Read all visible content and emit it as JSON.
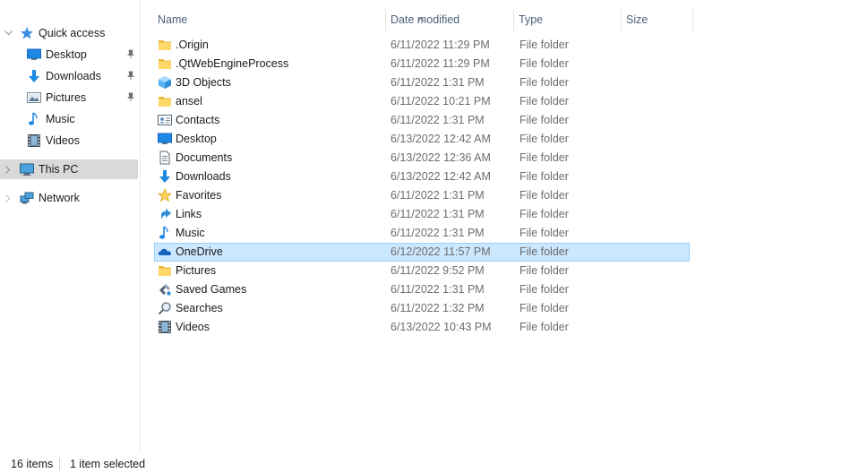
{
  "colors": {
    "accent": "#0078d7",
    "selection_bg": "#cce8ff",
    "selection_border": "#99d1ff",
    "nav_selected_bg": "#d9d9d9",
    "header_text": "#4c607a",
    "folder_yellow": "#ffd869"
  },
  "nav": {
    "items": [
      {
        "label": "Quick access",
        "icon": "star-icon",
        "pinned": false
      },
      {
        "label": "Desktop",
        "icon": "desktop-icon",
        "pinned": true
      },
      {
        "label": "Downloads",
        "icon": "download-icon",
        "pinned": true
      },
      {
        "label": "Pictures",
        "icon": "pictures-icon",
        "pinned": true
      },
      {
        "label": "Music",
        "icon": "music-icon",
        "pinned": false
      },
      {
        "label": "Videos",
        "icon": "videos-icon",
        "pinned": false
      },
      {
        "label": "This PC",
        "icon": "computer-icon",
        "pinned": false,
        "selected": true
      },
      {
        "label": "Network",
        "icon": "network-icon",
        "pinned": false
      }
    ]
  },
  "columns": {
    "name": "Name",
    "date_modified": "Date modified",
    "type": "Type",
    "size": "Size"
  },
  "files": [
    {
      "name": ".Origin",
      "date": "6/11/2022 11:29 PM",
      "type": "File folder",
      "icon": "folder-icon"
    },
    {
      "name": ".QtWebEngineProcess",
      "date": "6/11/2022 11:29 PM",
      "type": "File folder",
      "icon": "folder-icon"
    },
    {
      "name": "3D Objects",
      "date": "6/11/2022 1:31 PM",
      "type": "File folder",
      "icon": "3d-objects-icon"
    },
    {
      "name": "ansel",
      "date": "6/11/2022 10:21 PM",
      "type": "File folder",
      "icon": "folder-icon"
    },
    {
      "name": "Contacts",
      "date": "6/11/2022 1:31 PM",
      "type": "File folder",
      "icon": "contacts-icon"
    },
    {
      "name": "Desktop",
      "date": "6/13/2022 12:42 AM",
      "type": "File folder",
      "icon": "desktop-icon"
    },
    {
      "name": "Documents",
      "date": "6/13/2022 12:36 AM",
      "type": "File folder",
      "icon": "documents-icon"
    },
    {
      "name": "Downloads",
      "date": "6/13/2022 12:42 AM",
      "type": "File folder",
      "icon": "download-icon"
    },
    {
      "name": "Favorites",
      "date": "6/11/2022 1:31 PM",
      "type": "File folder",
      "icon": "star-icon"
    },
    {
      "name": "Links",
      "date": "6/11/2022 1:31 PM",
      "type": "File folder",
      "icon": "links-icon"
    },
    {
      "name": "Music",
      "date": "6/11/2022 1:31 PM",
      "type": "File folder",
      "icon": "music-icon"
    },
    {
      "name": "OneDrive",
      "date": "6/12/2022 11:57 PM",
      "type": "File folder",
      "icon": "onedrive-icon",
      "selected": true
    },
    {
      "name": "Pictures",
      "date": "6/11/2022 9:52 PM",
      "type": "File folder",
      "icon": "folder-icon"
    },
    {
      "name": "Saved Games",
      "date": "6/11/2022 1:31 PM",
      "type": "File folder",
      "icon": "saved-games-icon"
    },
    {
      "name": "Searches",
      "date": "6/11/2022 1:32 PM",
      "type": "File folder",
      "icon": "search-icon"
    },
    {
      "name": "Videos",
      "date": "6/13/2022 10:43 PM",
      "type": "File folder",
      "icon": "videos-icon"
    }
  ],
  "status": {
    "item_count": "16 items",
    "selection": "1 item selected"
  }
}
